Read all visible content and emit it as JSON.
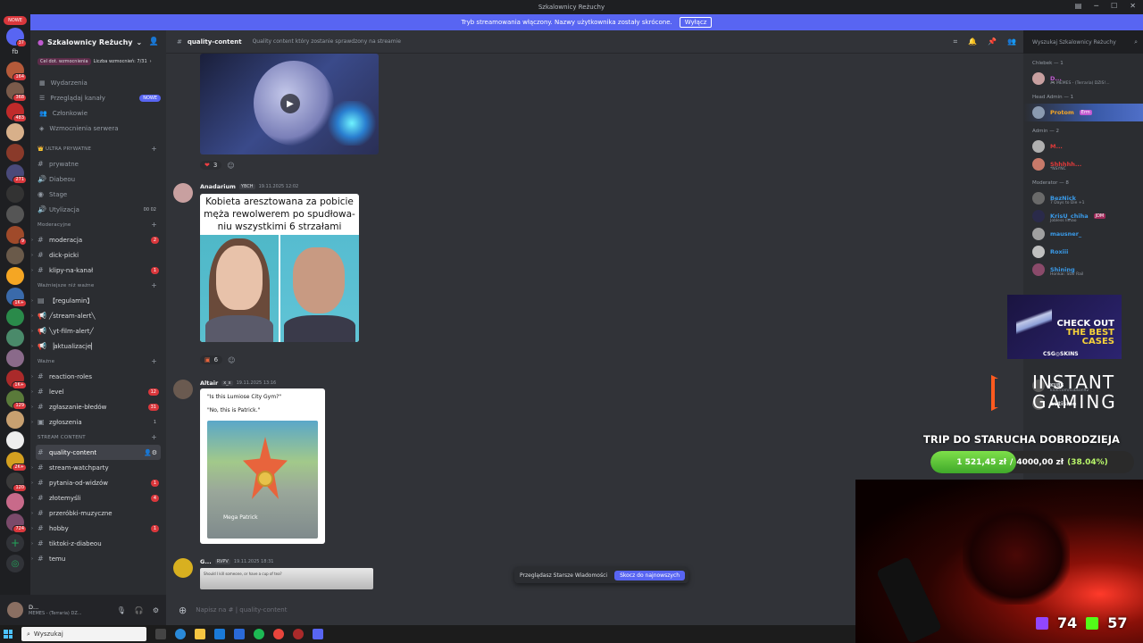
{
  "titlebar": {
    "title": "Szkalownicy Reżuchy"
  },
  "banner": {
    "text": "Tryb streamowania włączony. Nazwy użytkownika zostały skrócone.",
    "button": "Wyłącz"
  },
  "servers": {
    "new_label": "NOWE",
    "dm_badge": "37",
    "text_item": "fb",
    "badges": [
      "164",
      "368",
      "483",
      "",
      "",
      "271",
      "",
      "",
      "9",
      "",
      "",
      "1K+",
      "",
      "",
      "",
      "1K+",
      "129",
      "",
      "",
      "",
      "2K+",
      "120",
      "",
      "724"
    ]
  },
  "sidebar": {
    "guild_name": "Szkalownicy Reżuchy",
    "boost_goal": "Cel dot. wzmocnienia",
    "boost_count": "Liczba wzmocnień: 7/31",
    "nav": [
      {
        "label": "Wydarzenia",
        "badge": ""
      },
      {
        "label": "Przeglądaj kanały",
        "badge": "NOWE"
      },
      {
        "label": "Członkowie",
        "badge": ""
      },
      {
        "label": "Wzmocnienia serwera",
        "badge": ""
      }
    ],
    "cat_ultra": "👑 ULTRA PRYWATNE",
    "ultra": [
      {
        "name": "prywatne",
        "count": ""
      },
      {
        "name": "Diabeou",
        "count": ""
      },
      {
        "name": "Stage",
        "count": ""
      },
      {
        "name": "Utylizacja",
        "count": "00   02"
      }
    ],
    "cat_mod": "Moderacyjne",
    "mod": [
      {
        "name": "moderacja",
        "count": "2"
      },
      {
        "name": "dick-picki",
        "count": ""
      },
      {
        "name": "klipy-na-kanał",
        "count": "1"
      }
    ],
    "cat_important": "Ważniejsze niż ważne",
    "important": [
      {
        "name": "【regulamin】"
      },
      {
        "name": "╱stream-alert╲"
      },
      {
        "name": "╲yt-film-alert╱"
      },
      {
        "name": "▕aktualizacje▏"
      }
    ],
    "cat_wazne": "Ważne",
    "wazne": [
      {
        "name": "reaction-roles",
        "count": ""
      },
      {
        "name": "level",
        "count": "12"
      },
      {
        "name": "zgłaszanie-błedów",
        "count": "31"
      },
      {
        "name": "zgłoszenia",
        "count": "1"
      }
    ],
    "cat_stream": "STREAM CONTENT",
    "stream": [
      {
        "name": "quality-content",
        "count": ""
      },
      {
        "name": "stream-watchparty",
        "count": ""
      },
      {
        "name": "pytania-od-widzów",
        "count": "1"
      },
      {
        "name": "złotemyśli",
        "count": "4"
      },
      {
        "name": "przeróbki-muzyczne",
        "count": ""
      },
      {
        "name": "hobby",
        "count": "1"
      },
      {
        "name": "tiktoki-z-diabeou",
        "count": ""
      },
      {
        "name": "temu",
        "count": ""
      }
    ]
  },
  "userbar": {
    "name": "D...",
    "status": "MEMES - (Terraria) DZ..."
  },
  "channel": {
    "name": "quality-content",
    "topic": "Quality content który zostanie sprawdzony na streamie",
    "search_placeholder": "Wyszukaj Szkalownicy Reżuchy"
  },
  "messages": [
    {
      "reaction_count": "3"
    },
    {
      "author": "Anadarium",
      "tag": "YBCH",
      "time": "19.11.2025 12:02",
      "caption": "Kobieta aresztowana za pobicie męża rewolwerem po spudłowa-niu wszystkimi 6 strzałami",
      "reaction_count": "6"
    },
    {
      "author": "Altair",
      "tag": "x_x",
      "time": "19.11.2025 13:16",
      "line1": "\"Is this Lumiose City Gym?\"",
      "line2": "\"No, this is Patrick.\"",
      "img_label": "Mega Patrick"
    },
    {
      "author": "G...",
      "tag": "RVPV",
      "time": "19.11.2025 18:31",
      "preview": "Should I kill someone, or have a cup of tea?"
    }
  ],
  "jump_bar": {
    "text": "Przeglądasz Starsze Wiadomości",
    "button": "Skocz do najnowszych"
  },
  "composer": {
    "placeholder": "Napisz na #  | quality-content"
  },
  "members": {
    "cat1": "Chlebek — 1",
    "m1": {
      "name": "D...",
      "sub": "🎮 MEMES - (Terraria) DZIS!..."
    },
    "cat2": "Head Admin — 1",
    "m2": {
      "name": "Protom",
      "sub": "Erm"
    },
    "cat3": "Admin — 2",
    "m3": {
      "name": "M...",
      "sub": ""
    },
    "m4": {
      "name": "Shhhhh...",
      "sub": "*NSYNC"
    },
    "cat4": "Moderator — 8",
    "m5": {
      "name": "BezNick",
      "sub": "7 Days to Die +1"
    },
    "m6": {
      "name": "KrisU_chiha",
      "sub": "Jobless limao",
      "tag": "JDM"
    },
    "m7": {
      "name": "mausner_",
      "sub": ""
    },
    "m8": {
      "name": "Roxiii",
      "sub": ""
    },
    "m9": {
      "name": "Shining",
      "sub": "Honkai: Star Rail"
    },
    "cat5": "VIP — 4",
    "m10": {
      "name": "KUBS",
      "sub": "kick.com/kubson92"
    },
    "m11": {
      "name": "autisme",
      "sub": ""
    }
  },
  "overlay": {
    "ad_line1": "CHECK OUT",
    "ad_line2": "THE BEST",
    "ad_line3": "CASES",
    "ad_brand": "CSG◎SKINS",
    "ig_line1": "INSTANT",
    "ig_line2": "GAMING",
    "goal_title": "TRIP DO STARUCHA DOBRODZIEJA",
    "goal_current": "1 521,45 zł",
    "goal_sep": "/",
    "goal_target": "4000,00 zł",
    "goal_pct": "(38.04%)",
    "goal_fraction": 0.3804,
    "twitch_viewers": "74",
    "kick_viewers": "57"
  },
  "taskbar": {
    "search": "Wyszukaj"
  }
}
